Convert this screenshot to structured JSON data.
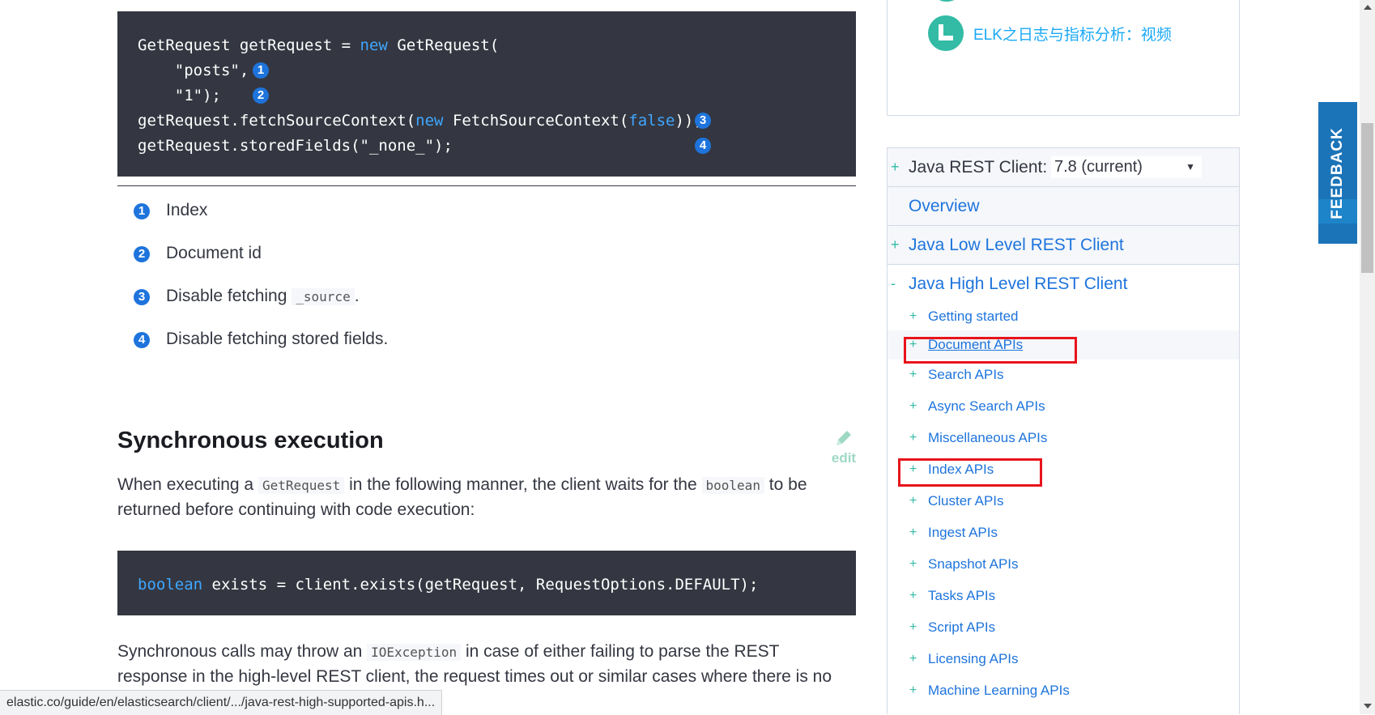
{
  "code_block_1": {
    "line1": {
      "pre": "GetRequest getRequest = ",
      "kw": "new",
      "post": " GetRequest("
    },
    "line2": "    \"posts\", ",
    "line3": "    \"1\");    ",
    "line4": {
      "pre": "getRequest.fetchSourceContext(",
      "kw1": "new",
      "mid": " FetchSourceContext(",
      "kw2": "false",
      "post": "));"
    },
    "line5": "getRequest.storedFields(\"_none_\");",
    "callouts": [
      "1",
      "2",
      "3",
      "4"
    ]
  },
  "callout_list": [
    {
      "num": "1",
      "text": "Index"
    },
    {
      "num": "2",
      "text": "Document id"
    },
    {
      "num": "3",
      "text_pre": "Disable fetching ",
      "code": "_source",
      "text_post": "."
    },
    {
      "num": "4",
      "text": "Disable fetching stored fields."
    }
  ],
  "section": {
    "title": "Synchronous execution",
    "edit_label": "edit",
    "para1": {
      "t1": "When executing a ",
      "c1": "GetRequest",
      "t2": " in the following manner, the client waits for the ",
      "c2": "boolean",
      "t3": " to be returned before continuing with code execution:"
    },
    "code": {
      "kw": "boolean",
      "rest": " exists = client.exists(getRequest, RequestOptions.DEFAULT);"
    },
    "para2": {
      "t1": "Synchronous calls may throw an ",
      "c1": "IOException",
      "t2": " in case of either failing to parse the REST response in the high-level REST client, the request times out or similar cases where there is no"
    }
  },
  "status_bar": {
    "url": "elastic.co/guide/en/elasticsearch/client/.../java-rest-high-supported-apis.h..."
  },
  "promo": {
    "title": "ELK之日志与指标分析：视频"
  },
  "toc": {
    "client_label": "Java REST Client:",
    "version": "7.8 (current)",
    "overview": "Overview",
    "low_level": "Java Low Level REST Client",
    "high_level": "Java High Level REST Client",
    "plus": "+",
    "minus": "-",
    "items": [
      "Getting started",
      "Document APIs",
      "Search APIs",
      "Async Search APIs",
      "Miscellaneous APIs",
      "Index APIs",
      "Cluster APIs",
      "Ingest APIs",
      "Snapshot APIs",
      "Tasks APIs",
      "Script APIs",
      "Licensing APIs",
      "Machine Learning APIs"
    ]
  },
  "feedback": {
    "label": "FEEDBACK"
  },
  "colors": {
    "code_bg": "#343741",
    "link": "#1e74dc",
    "accent_green": "#33bba5",
    "highlight_red": "#e8141c",
    "feedback_blue": "#1c74b8"
  }
}
